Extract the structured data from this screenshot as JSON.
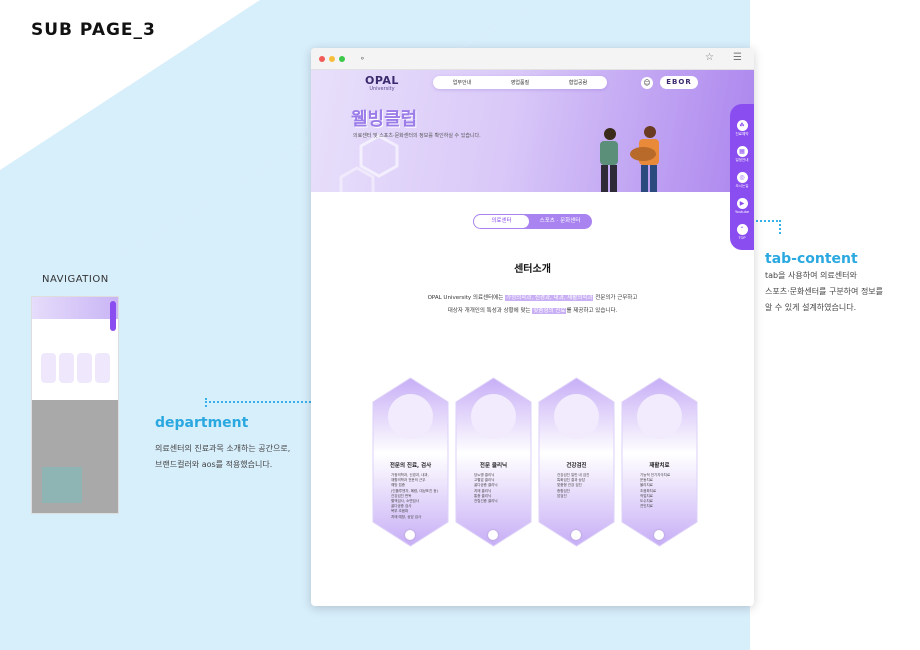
{
  "page_label": "SUB PAGE_3",
  "navigation": {
    "title": "NAVIGATION"
  },
  "annotations": {
    "tab_content": {
      "title": "tab-content",
      "lines": [
        "tab을 사용하여 의료센터와",
        "스포츠·문화센터를 구분하여 정보를",
        "알 수 있게  설계하였습니다."
      ]
    },
    "department": {
      "title": "department",
      "lines": [
        "의료센터의 진료과목 소개하는 공간으로,",
        "브랜드컬러와 aos를 적용했습니다."
      ]
    }
  },
  "browser": {
    "logo": {
      "main": "OPAL",
      "sub": "University"
    },
    "nav_items": [
      "업무안내",
      "영업품질",
      "협업공람"
    ],
    "ebor": "EBOR",
    "hero": {
      "title": "웰빙클럽",
      "subtitle": "의료센터 및 스포츠·문화센터의 정보를 확인하실 수 있습니다."
    },
    "sidebar": [
      {
        "icon": "leaf-icon",
        "label": "진료예약"
      },
      {
        "icon": "calendar-icon",
        "label": "일정안내"
      },
      {
        "icon": "target-icon",
        "label": "오시는길"
      },
      {
        "icon": "youtube-icon",
        "label": "Youtube"
      },
      {
        "icon": "arrow-up-icon",
        "label": "TOP"
      }
    ],
    "tabs": [
      {
        "label": "의료센터",
        "active": true
      },
      {
        "label": "스포츠 · 문화센터",
        "active": false
      }
    ],
    "section_title": "센터소개",
    "intro": {
      "line1_before": "OPAL University 의료센터에는 ",
      "line1_hl": "가정의학과, 신경과, 내과, 재활의학과",
      "line1_after": " 전문의가 근무하고",
      "line2_before": "대상자 개개인의 특성과 상황에 맞는 ",
      "line2_hl": "맞춤형의 진료",
      "line2_after": "를 제공하고 있습니다."
    },
    "departments": [
      {
        "title": "전문의 진료, 검사",
        "items": [
          "가정의학과, 신경과, 내과,",
          "재활의학과 전문의 근무",
          "예방 접종",
          "(인플루엔자, 폐렴, 대상포진 등)",
          "건강검진 판독",
          "혈액검사, 소변검사",
          "골다공증 검사",
          "복부 초음파",
          "치매 예방, 상담 검사"
        ]
      },
      {
        "title": "전문 클리닉",
        "items": [
          "당뇨병 클리닉",
          "고혈압 클리닉",
          "골다공증 클리닉",
          "치매 클리닉",
          "통증 클리닉",
          "전립선증 클리닉"
        ]
      },
      {
        "title": "건강검진",
        "items": [
          "건강검진 일반 내 검진",
          "특화검진 결과 상담",
          "맞춤형 건강 검진",
          "종합검진",
          "암검진"
        ]
      },
      {
        "title": "재활치료",
        "items": [
          "기능적 전기자극치료",
          "운동치료",
          "물리치료",
          "초음파치료",
          "작업치료",
          "도수치료",
          "견인치료"
        ]
      }
    ]
  },
  "colors": {
    "accent": "#8a4df0",
    "annotation": "#2aa8e0",
    "background_shape": "#d9f0fb"
  }
}
